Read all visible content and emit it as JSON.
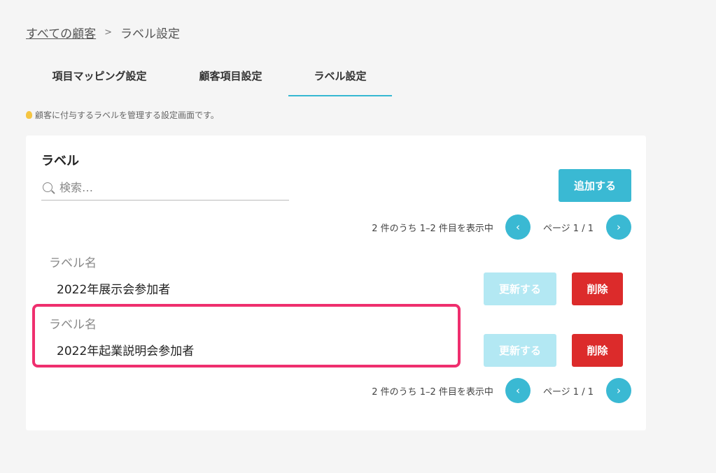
{
  "breadcrumb": {
    "parent": "すべての顧客",
    "separator": ">",
    "current": "ラベル設定"
  },
  "tabs": [
    {
      "label": "項目マッピング設定"
    },
    {
      "label": "顧客項目設定"
    },
    {
      "label": "ラベル設定",
      "active": true
    }
  ],
  "hint": {
    "icon": "lightbulb-icon",
    "text": "顧客に付与するラベルを管理する設定画面です。"
  },
  "panel": {
    "title": "ラベル",
    "search": {
      "placeholder": "検索…",
      "value": ""
    },
    "add_label": "追加する",
    "pagination": {
      "summary": "2 件のうち 1–2 件目を表示中",
      "page_label": "ページ 1 / 1",
      "prev_icon": "‹",
      "next_icon": "›"
    },
    "rows": [
      {
        "field_label": "ラベル名",
        "value": "2022年展示会参加者",
        "update_label": "更新する",
        "delete_label": "削除"
      },
      {
        "field_label": "ラベル名",
        "value": "2022年起業説明会参加者",
        "update_label": "更新する",
        "delete_label": "削除"
      }
    ]
  },
  "colors": {
    "accent": "#3ab9d3",
    "accent_disabled": "#b3e8f3",
    "danger": "#dc2b2b",
    "highlight": "#ef2f6e"
  }
}
